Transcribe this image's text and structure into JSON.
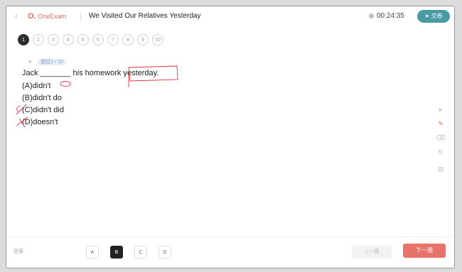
{
  "header": {
    "back_icon": "chevron-left-icon",
    "logo_mark": "O.",
    "logo_text": "OneExam",
    "title": "We Visited Our Relatives Yesterday",
    "timer": "00:24:35",
    "submit_label": "交卷"
  },
  "question_nav": [
    "1",
    "2",
    "3",
    "4",
    "5",
    "6",
    "7",
    "8",
    "9",
    "10"
  ],
  "current_question": "1",
  "question": {
    "counter": "题目1 / 10",
    "stem": "Jack _______ his homework yesterday.",
    "options": [
      "(A)didn't",
      "(B)didn't do",
      "(C)didn't did",
      "(D)doesn't"
    ]
  },
  "tools": [
    "pointer-icon",
    "pen-icon",
    "eraser-icon",
    "refresh-icon",
    "book-icon"
  ],
  "footer": {
    "hint": "答案",
    "answers": [
      "A",
      "B",
      "C",
      "D"
    ],
    "selected": "B",
    "prev_label": "上一题",
    "next_label": "下一题"
  },
  "colors": {
    "accent": "#4a9aa4",
    "next": "#e8736b",
    "logo": "#e8695a",
    "annotation": "#e0303a"
  }
}
